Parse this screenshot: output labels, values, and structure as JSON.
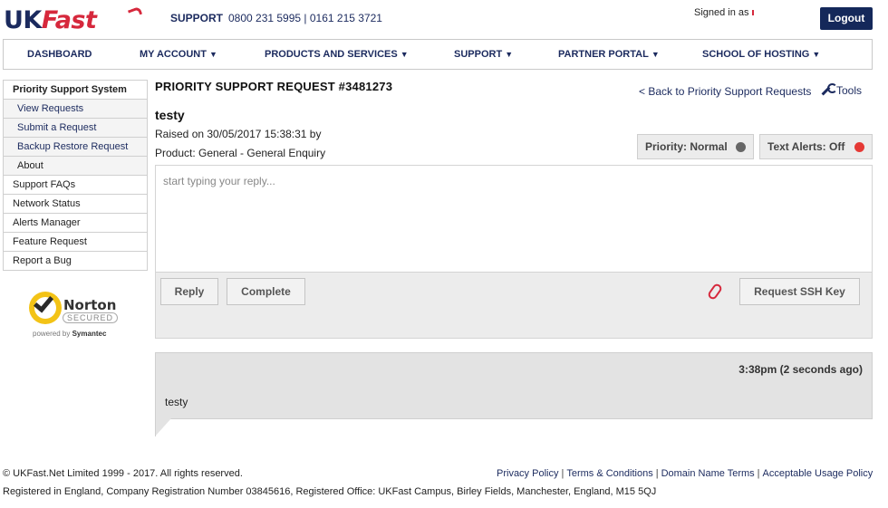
{
  "header": {
    "logo_uk": "UK",
    "logo_fast": "Fast",
    "support_label": "SUPPORT",
    "support_phones": "0800 231 5995 | 0161 215 3721",
    "signed_in": "Signed in as",
    "logout_label": "Logout"
  },
  "nav": {
    "items": [
      {
        "label": "DASHBOARD",
        "caret": ""
      },
      {
        "label": "MY ACCOUNT",
        "caret": "▼"
      },
      {
        "label": "PRODUCTS AND SERVICES",
        "caret": "▼"
      },
      {
        "label": "SUPPORT",
        "caret": "▼"
      },
      {
        "label": "PARTNER PORTAL",
        "caret": "▼"
      },
      {
        "label": "SCHOOL OF HOSTING",
        "caret": "▼"
      }
    ]
  },
  "sidebar": {
    "items": [
      {
        "label": "Priority Support System"
      },
      {
        "label": "View Requests"
      },
      {
        "label": "Submit a Request"
      },
      {
        "label": "Backup Restore Request"
      },
      {
        "label": "About"
      },
      {
        "label": "Support FAQs"
      },
      {
        "label": "Network Status"
      },
      {
        "label": "Alerts Manager"
      },
      {
        "label": "Feature Request"
      },
      {
        "label": "Report a Bug"
      }
    ]
  },
  "norton": {
    "name": "Norton",
    "secured": "SECURED",
    "powered_by": "powered by",
    "symantec": "Symantec"
  },
  "request": {
    "title": "PRIORITY SUPPORT REQUEST #3481273",
    "back_link": "< Back to Priority Support Requests",
    "tools_label": "Tools",
    "subject": "testy",
    "raised": "Raised on 30/05/2017 15:38:31 by",
    "product": "Product: General - General Enquiry",
    "priority": {
      "label": "Priority: Normal",
      "color": "#666666"
    },
    "text_alerts": {
      "label": "Text Alerts: Off",
      "color": "#e53935"
    }
  },
  "reply": {
    "placeholder": "start typing your reply...",
    "value": "",
    "reply_button": "Reply",
    "complete_button": "Complete",
    "ssh_button": "Request SSH Key"
  },
  "messages": [
    {
      "time": "3:38pm (2 seconds ago)",
      "text": "testy"
    }
  ],
  "footer": {
    "copyright": "© UKFast.Net Limited 1999 - 2017. All rights reserved.",
    "links": [
      "Privacy Policy",
      "Terms & Conditions",
      "Domain Name Terms",
      "Acceptable Usage Policy"
    ],
    "registered": "Registered in England, Company Registration Number 03845616, Registered Office: UKFast Campus, Birley Fields, Manchester, England, M15 5QJ"
  },
  "colors": {
    "brand_navy": "#1b2a5e",
    "brand_red": "#d6283c",
    "logout_bg": "#14285a"
  }
}
